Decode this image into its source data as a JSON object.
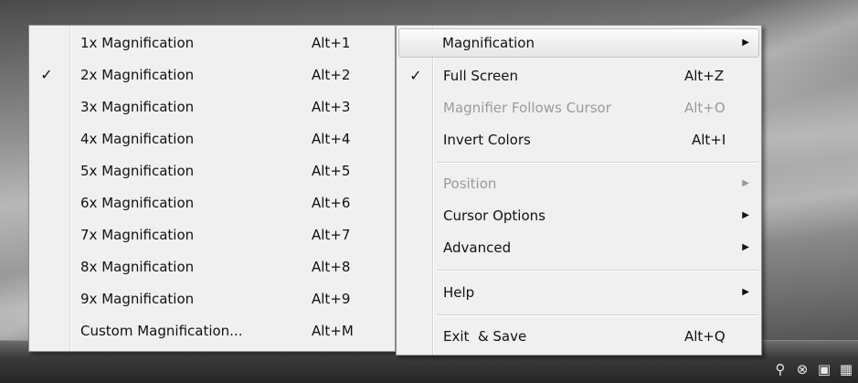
{
  "magnification_submenu": {
    "items": [
      {
        "label": "1x Magnification",
        "shortcut": "Alt+1",
        "checked": false
      },
      {
        "label": "2x Magnification",
        "shortcut": "Alt+2",
        "checked": true
      },
      {
        "label": "3x Magnification",
        "shortcut": "Alt+3",
        "checked": false
      },
      {
        "label": "4x Magnification",
        "shortcut": "Alt+4",
        "checked": false
      },
      {
        "label": "5x Magnification",
        "shortcut": "Alt+5",
        "checked": false
      },
      {
        "label": "6x Magnification",
        "shortcut": "Alt+6",
        "checked": false
      },
      {
        "label": "7x Magnification",
        "shortcut": "Alt+7",
        "checked": false
      },
      {
        "label": "8x Magnification",
        "shortcut": "Alt+8",
        "checked": false
      },
      {
        "label": "9x Magnification",
        "shortcut": "Alt+9",
        "checked": false
      },
      {
        "label": "Custom Magnification...",
        "shortcut": "Alt+M",
        "checked": false
      }
    ]
  },
  "main_menu": {
    "magnification": {
      "label": "Magnification",
      "submenu": true,
      "highlighted": true
    },
    "full_screen": {
      "label": "Full Screen",
      "shortcut": "Alt+Z",
      "checked": true
    },
    "follows_cursor": {
      "label": "Magnifier Follows Cursor",
      "shortcut": "Alt+O",
      "disabled": true
    },
    "invert_colors": {
      "label": "Invert Colors",
      "shortcut": "Alt+I"
    },
    "position": {
      "label": "Position",
      "submenu": true,
      "disabled": true
    },
    "cursor_options": {
      "label": "Cursor Options",
      "submenu": true
    },
    "advanced": {
      "label": "Advanced",
      "submenu": true
    },
    "help": {
      "label": "Help",
      "submenu": true
    },
    "exit_save": {
      "label": "Exit  & Save",
      "shortcut": "Alt+Q"
    }
  },
  "glyphs": {
    "check": "✓",
    "arrow": "▶"
  },
  "tray_icons": [
    "magnifier-icon",
    "close-circle-icon",
    "network-icon",
    "volume-icon"
  ]
}
